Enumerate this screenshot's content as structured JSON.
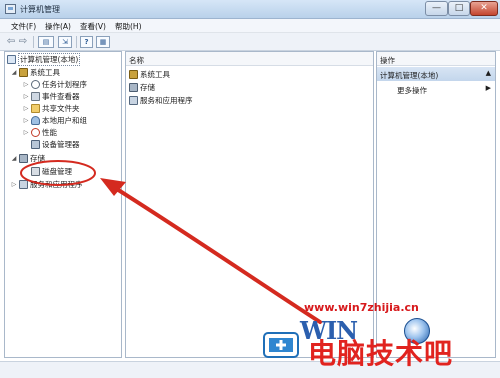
{
  "window": {
    "title": "计算机管理",
    "min_glyph": "—",
    "max_glyph": "□",
    "close_glyph": "✕"
  },
  "menu": [
    "文件(F)",
    "操作(A)",
    "查看(V)",
    "帮助(H)"
  ],
  "toolbar": {
    "help_label": "?"
  },
  "tree": {
    "root": "计算机管理(本地)",
    "system_tools": "系统工具",
    "task_scheduler": "任务计划程序",
    "event_viewer": "事件查看器",
    "shared_folders": "共享文件夹",
    "local_users": "本地用户和组",
    "performance": "性能",
    "device_manager": "设备管理器",
    "storage": "存储",
    "disk_management": "磁盘管理",
    "services_apps": "服务和应用程序"
  },
  "content": {
    "column_name": "名称",
    "items": [
      "系统工具",
      "存储",
      "服务和应用程序"
    ]
  },
  "actions": {
    "header": "操作",
    "section": "计算机管理(本地)",
    "more": "更多操作"
  },
  "watermark": {
    "url": "www.win7zhijia.cn",
    "brand": "WIN",
    "cn": "电脑技术吧"
  },
  "colors": {
    "annotation": "#d42a1f",
    "accent": "#2b5fae",
    "watermark_red": "#e1231f"
  }
}
